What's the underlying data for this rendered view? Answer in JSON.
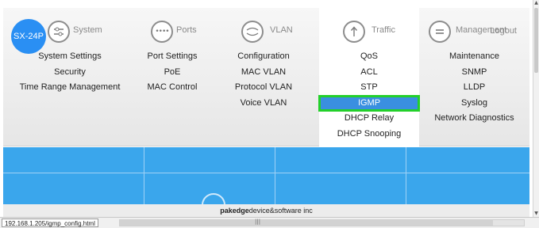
{
  "brand": {
    "label": "SX-24P"
  },
  "logout": {
    "label": "Logout"
  },
  "menu": [
    {
      "key": "system",
      "title": "System",
      "icon": "equalizer-icon",
      "active": false,
      "items": [
        "System Settings",
        "Security",
        "Time Range Management"
      ]
    },
    {
      "key": "ports",
      "title": "Ports",
      "icon": "ports-icon",
      "active": false,
      "items": [
        "Port Settings",
        "PoE",
        "MAC Control"
      ]
    },
    {
      "key": "vlan",
      "title": "VLAN",
      "icon": "vlan-icon",
      "active": false,
      "items": [
        "Configuration",
        "MAC VLAN",
        "Protocol VLAN",
        "Voice VLAN"
      ]
    },
    {
      "key": "traffic",
      "title": "Traffic",
      "icon": "arrow-up-icon",
      "active": true,
      "items": [
        "QoS",
        "ACL",
        "STP",
        "IGMP",
        "DHCP Relay",
        "DHCP Snooping"
      ],
      "highlighted": "IGMP"
    },
    {
      "key": "management",
      "title": "Management",
      "icon": "menu-lines-icon",
      "active": false,
      "items": [
        "Maintenance",
        "SNMP",
        "LLDP",
        "Syslog",
        "Network Diagnostics"
      ]
    }
  ],
  "footer": {
    "brand": "pakedge",
    "rest": "device&software inc"
  },
  "statusbar": {
    "url": "192.168.1.205/igmp_config.html"
  },
  "colors": {
    "accent": "#2a8ff3",
    "highlight": "#3a8fe0",
    "highlight_border": "#23d02a",
    "content_bg": "#3aa6ec"
  }
}
